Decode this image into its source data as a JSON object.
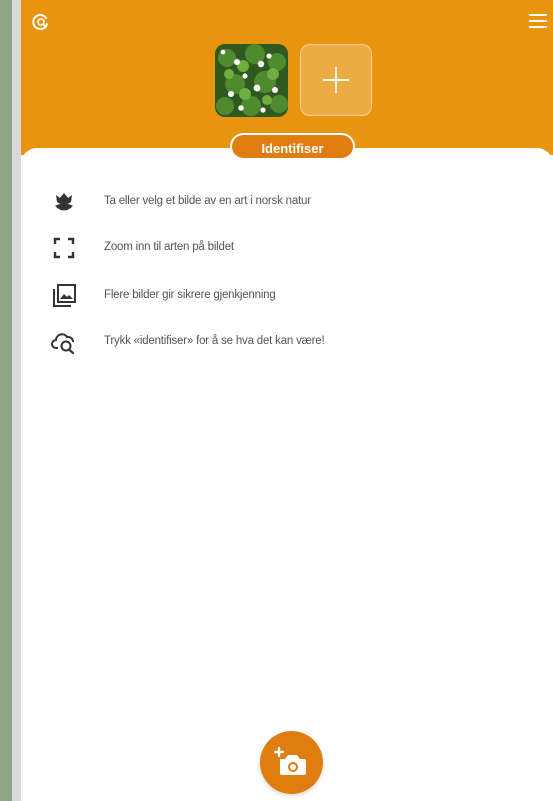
{
  "header": {
    "bg_color": "#e8940f",
    "top_left_icon": "refresh-search-icon",
    "menu_icon": "hamburger-menu-icon",
    "add_photo_icon": "plus-icon"
  },
  "identify_button": {
    "label": "Identifiser",
    "color": "#e07d10"
  },
  "hints": [
    {
      "icon": "tulip-icon",
      "text": "Ta eller velg et bilde av en art i norsk natur"
    },
    {
      "icon": "zoom-frame-icon",
      "text": "Zoom inn til arten på bildet"
    },
    {
      "icon": "image-gallery-icon",
      "text": "Flere bilder gir sikrere gjenkjenning"
    },
    {
      "icon": "cloud-search-icon",
      "text": "Trykk «identifiser» for å se hva det kan være!"
    }
  ],
  "camera_button": {
    "icon": "add-camera-icon",
    "color": "#e07d10"
  }
}
